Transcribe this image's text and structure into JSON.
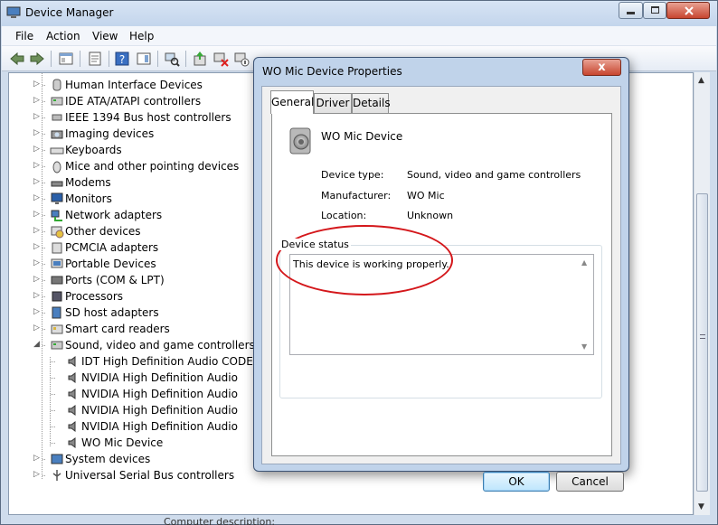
{
  "window": {
    "title": "Device Manager"
  },
  "menu": [
    "File",
    "Action",
    "View",
    "Help"
  ],
  "tree": {
    "categories": [
      "Human Interface Devices",
      "IDE ATA/ATAPI controllers",
      "IEEE 1394 Bus host controllers",
      "Imaging devices",
      "Keyboards",
      "Mice and other pointing devices",
      "Modems",
      "Monitors",
      "Network adapters",
      "Other devices",
      "PCMCIA adapters",
      "Portable Devices",
      "Ports (COM & LPT)",
      "Processors",
      "SD host adapters",
      "Smart card readers",
      "Sound, video and game controllers"
    ],
    "sound_children": [
      "IDT High Definition Audio CODEC",
      "NVIDIA High Definition Audio",
      "NVIDIA High Definition Audio",
      "NVIDIA High Definition Audio",
      "NVIDIA High Definition Audio",
      "WO Mic Device"
    ],
    "after": [
      "System devices",
      "Universal Serial Bus controllers"
    ],
    "collapsed_glyph": "▷",
    "expanded_glyph": "◢"
  },
  "bottom_clip_text": "Computer description:",
  "dialog": {
    "title": "WO Mic Device Properties",
    "close_glyph": "x",
    "tabs": [
      "General",
      "Driver",
      "Details"
    ],
    "device_name": "WO Mic Device",
    "props": [
      {
        "label": "Device type:",
        "value": "Sound, video and game controllers"
      },
      {
        "label": "Manufacturer:",
        "value": "WO Mic"
      },
      {
        "label": "Location:",
        "value": "Unknown"
      }
    ],
    "status_label": "Device status",
    "status_text": "This device is working properly.",
    "ok_label": "OK",
    "cancel_label": "Cancel"
  },
  "colors": {
    "annotation": "#d4171b",
    "titlebar": "#c3d5ec"
  }
}
